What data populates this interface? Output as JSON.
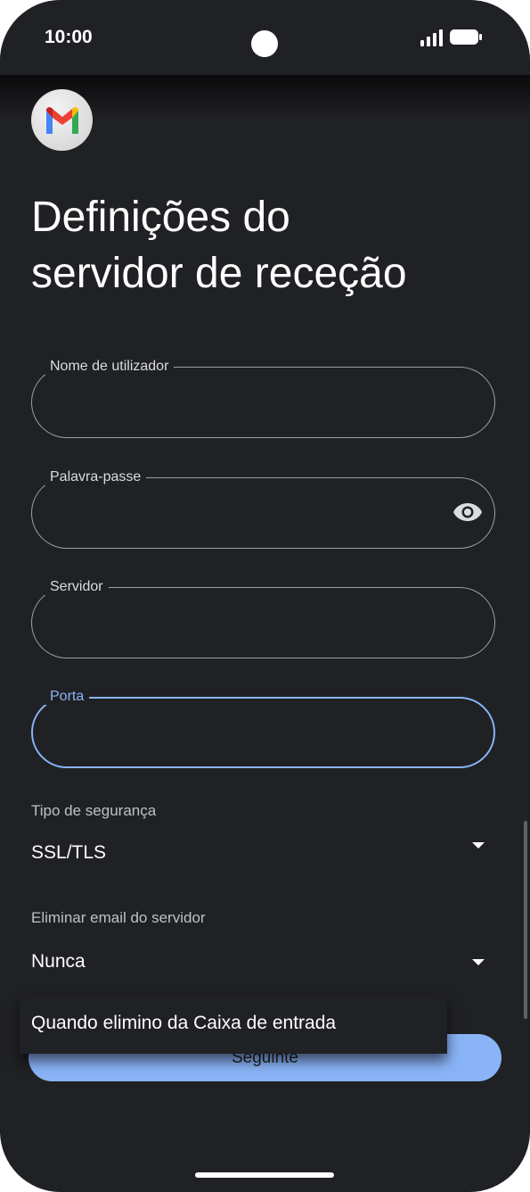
{
  "status_bar": {
    "time": "10:00"
  },
  "page": {
    "title_line1": "Definições do",
    "title_line2": "servidor de receção"
  },
  "fields": {
    "username": {
      "label": "Nome de utilizador",
      "value": ""
    },
    "password": {
      "label": "Palavra-passe",
      "value": ""
    },
    "server": {
      "label": "Servidor",
      "value": ""
    },
    "port": {
      "label": "Porta",
      "value": ""
    }
  },
  "security": {
    "label": "Tipo de segurança",
    "value": "SSL/TLS"
  },
  "delete_email": {
    "label": "Eliminar email do servidor",
    "value": "Nunca",
    "options": [
      "Quando elimino da Caixa de entrada"
    ]
  },
  "next_button": {
    "label": "Seguinte"
  },
  "colors": {
    "background": "#202124",
    "accent": "#8ab4f8"
  }
}
